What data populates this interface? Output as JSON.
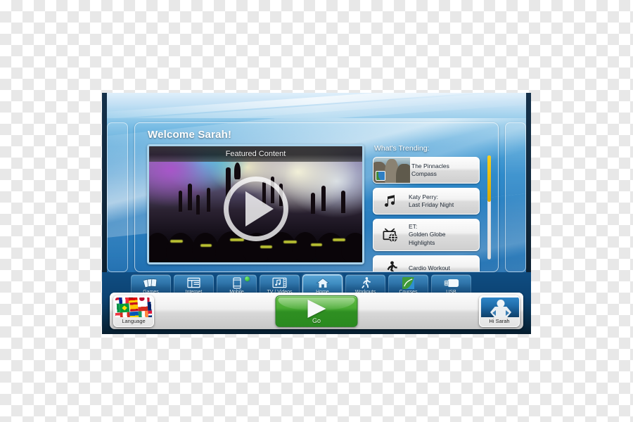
{
  "screen": {
    "welcome_title": "Welcome Sarah!"
  },
  "featured": {
    "label": "Featured Content",
    "play_icon": "play-icon"
  },
  "trending": {
    "title": "What's Trending:",
    "items": [
      {
        "icon": "photo-thumbnail",
        "lines": [
          "The Pinnacles",
          "Compass"
        ]
      },
      {
        "icon": "music-note-icon",
        "lines": [
          "Katy Perry:",
          "Last Friday Night"
        ]
      },
      {
        "icon": "tv-globe-icon",
        "lines": [
          "ET:",
          "Golden Globe",
          "Highlights"
        ]
      },
      {
        "icon": "running-person-icon",
        "lines": [
          "Cardio Workout"
        ]
      }
    ]
  },
  "nav": {
    "items": [
      {
        "label": "Games",
        "icon": "playing-cards-icon",
        "active": false,
        "badge": false
      },
      {
        "label": "Internet",
        "icon": "browser-window-icon",
        "active": false,
        "badge": false
      },
      {
        "label": "Mobile",
        "icon": "smartphone-icon",
        "active": false,
        "badge": true
      },
      {
        "label": "TV / Videos",
        "icon": "tv-media-icon",
        "active": false,
        "badge": false
      },
      {
        "label": "Home",
        "icon": "home-icon",
        "active": true,
        "badge": false
      },
      {
        "label": "Workouts",
        "icon": "running-person-icon",
        "active": false,
        "badge": false
      },
      {
        "label": "Courses",
        "icon": "courses-logo-icon",
        "active": false,
        "badge": false
      },
      {
        "label": "USB",
        "icon": "usb-drive-icon",
        "active": false,
        "badge": false
      }
    ]
  },
  "actionbar": {
    "language_label": "Language",
    "language_icon": "world-flags-icon",
    "go_label": "Go",
    "go_icon": "right-arrow-icon",
    "user_label": "Hi Sarah",
    "user_icon": "user-avatar-icon"
  },
  "colors": {
    "accent_blue": "#2a7fc0",
    "go_green": "#49ab33",
    "scrollbar_gold": "#f6cf1c",
    "badge_green": "#1ea61e"
  }
}
